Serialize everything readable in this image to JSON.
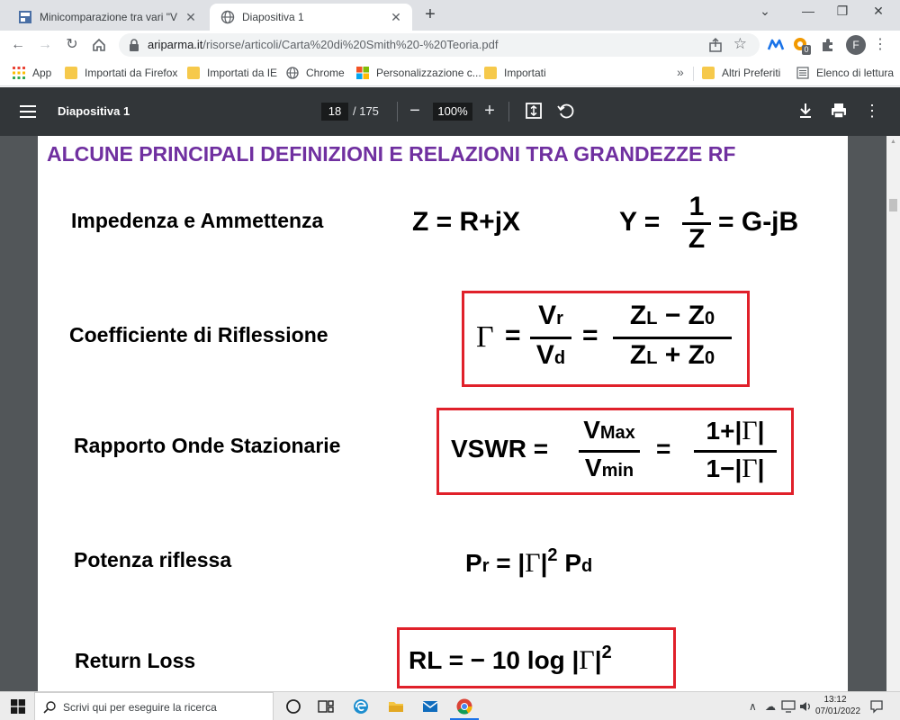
{
  "browser": {
    "tabs": [
      {
        "title": "Minicomparazione tra vari \"VNA\"",
        "close": "✕"
      },
      {
        "title": "Diapositiva 1",
        "close": "✕"
      }
    ],
    "new_tab": "+",
    "window_controls": {
      "minimize": "⌄",
      "restore": "—",
      "maximize": "❐",
      "close": "✕"
    },
    "url_domain": "ariparma.it",
    "url_path": "/risorse/articoli/Carta%20di%20Smith%20-%20Teoria.pdf",
    "avatar_letter": "F",
    "extension_badge": "0"
  },
  "bookmarks": {
    "items": [
      {
        "label": "App",
        "icon": "apps-grid-icon"
      },
      {
        "label": "Importati da Firefox",
        "icon": "folder-icon"
      },
      {
        "label": "Importati da IE",
        "icon": "folder-icon"
      },
      {
        "label": "Chrome",
        "icon": "globe-icon"
      },
      {
        "label": "Personalizzazione c...",
        "icon": "windows-logo-icon"
      },
      {
        "label": "Importati",
        "icon": "folder-icon"
      }
    ],
    "more": "»",
    "other": "Altri Preferiti",
    "reading_list": "Elenco di lettura"
  },
  "pdf_viewer": {
    "title": "Diapositiva 1",
    "current_page": "18",
    "total_pages": "/ 175",
    "zoom": "100%",
    "zoom_out": "−",
    "zoom_in": "+"
  },
  "slide": {
    "heading": "ALCUNE  PRINCIPALI  DEFINIZIONI E RELAZIONI TRA GRANDEZZE  RF",
    "rows": {
      "impedance": {
        "label": "Impedenza e Ammettenza",
        "formula_z": "Z = R+jX"
      },
      "reflection": {
        "label": "Coefficiente di Riflessione"
      },
      "vswr": {
        "label": "Rapporto Onde Stazionarie"
      },
      "power": {
        "label": "Potenza riflessa"
      },
      "return_loss": {
        "label": "Return Loss"
      }
    }
  },
  "taskbar": {
    "search_placeholder": "Scrivi qui per eseguire la ricerca",
    "time": "13:12",
    "date": "07/01/2022"
  },
  "colors": {
    "heading": "#7030a0",
    "box_border": "#e0202a",
    "pdf_toolbar": "#323639",
    "viewer_bg": "#525659"
  }
}
